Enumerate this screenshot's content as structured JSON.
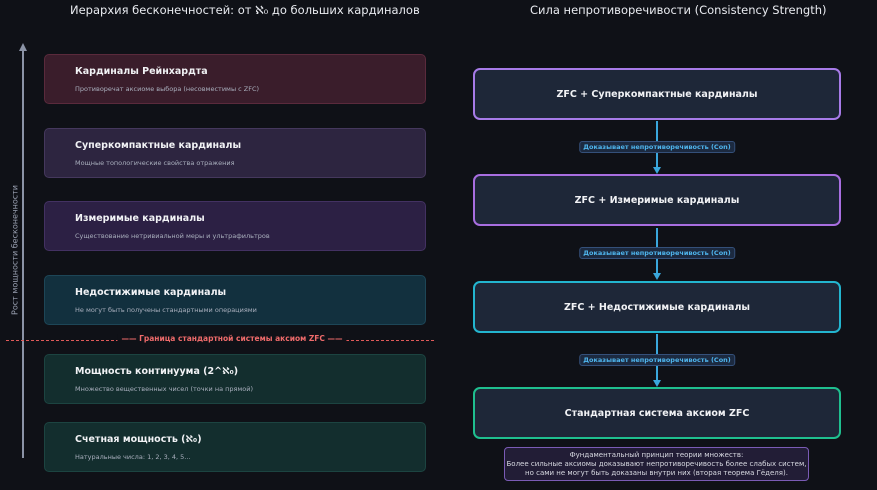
{
  "titles": {
    "left": "Иерархия бесконечностей: от ℵ₀ до больших кардиналов",
    "right": "Сила непротиворечивости (Consistency Strength)"
  },
  "axis": {
    "label": "Рост мощности бесконечности"
  },
  "hierarchy": [
    {
      "title": "Кардиналы Рейнхардта",
      "desc": "Противоречат аксиоме выбора (несовместимы с ZFC)"
    },
    {
      "title": "Суперкомпактные кардиналы",
      "desc": "Мощные топологические свойства отражения"
    },
    {
      "title": "Измеримые кардиналы",
      "desc": "Существование нетривиальной меры и ультрафильтров"
    },
    {
      "title": "Недостижимые кардиналы",
      "desc": "Не могут быть получены стандартными операциями"
    },
    {
      "title": "Мощность континуума (2^ℵ₀)",
      "desc": "Множество вещественных чисел (точки на прямой)"
    },
    {
      "title": "Счетная мощность (ℵ₀)",
      "desc": "Натуральные числа: 1, 2, 3, 4, 5..."
    }
  ],
  "boundary": {
    "label": "—— Граница стандартной системы аксиом ZFC ——"
  },
  "strength": [
    {
      "title": "ZFC + Суперкомпактные кардиналы"
    },
    {
      "title": "ZFC + Измеримые кардиналы"
    },
    {
      "title": "ZFC + Недостижимые кардиналы"
    },
    {
      "title": "Стандартная система аксиом ZFC"
    }
  ],
  "connectors": [
    {
      "label": "Доказывает непротиворечивость (Con)"
    },
    {
      "label": "Доказывает непротиворечивость (Con)"
    },
    {
      "label": "Доказывает непротиворечивость (Con)"
    }
  ],
  "note": {
    "line1": "Фундаментальный принцип теории множеств:",
    "line2": "Более сильные аксиомы доказывают непротиворечивость более слабых систем,",
    "line3": "но сами не могут быть доказаны внутри них (вторая теорема Гёделя)."
  },
  "colors": {
    "background": "#0f1117",
    "boundary": "#e05a5a",
    "connector": "#3aa7dc"
  }
}
